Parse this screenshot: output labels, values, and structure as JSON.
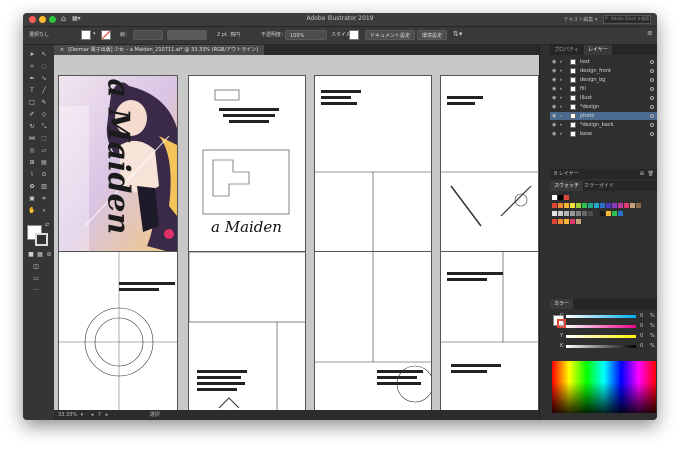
{
  "window": {
    "title": "Adobe Illustrator 2019",
    "workspace_label": "テキスト編集",
    "stock_search_placeholder": "Adobe Stock を検索"
  },
  "control_bar": {
    "selection_label": "選択なし",
    "stroke_label": "線：",
    "stroke_weight": "2 pt. 楕円",
    "opacity_label": "不透明度：",
    "opacity_value": "100%",
    "style_label": "スタイル：",
    "doc_settings_button": "ドキュメント設定",
    "preferences_button": "環境設定"
  },
  "document_tab": {
    "label": "[Dermar 電子出版] 少女 – a Maiden_210711.ai* @ 33.33% (RGB/アウトライン)",
    "close": "×"
  },
  "status": {
    "zoom": "33.33%",
    "page": "7",
    "tool": "選択"
  },
  "artwork": {
    "cover_title": "a Maiden",
    "spread_title": "a Maiden"
  },
  "panels": {
    "tab_properties": "プロパティ",
    "tab_layers": "レイヤー",
    "layers_footer": "8 レイヤー",
    "tab_swatches": "スウォッチ",
    "tab_color_guide": "カラーガイド",
    "tab_color": "カラー"
  },
  "layers": [
    {
      "name": "text",
      "selected": false
    },
    {
      "name": "design_front",
      "selected": false
    },
    {
      "name": "design_bg",
      "selected": false
    },
    {
      "name": "fill",
      "selected": false
    },
    {
      "name": "Illust",
      "selected": false
    },
    {
      "name": "*design",
      "selected": false
    },
    {
      "name": "photo",
      "selected": true
    },
    {
      "name": "*design_back",
      "selected": false
    },
    {
      "name": "base",
      "selected": false
    }
  ],
  "color": {
    "channels": [
      {
        "label": "C",
        "value": "0",
        "unit": "%"
      },
      {
        "label": "M",
        "value": "0",
        "unit": "%"
      },
      {
        "label": "Y",
        "value": "0",
        "unit": "%"
      },
      {
        "label": "K",
        "value": "0",
        "unit": "%"
      }
    ]
  },
  "colors": {
    "window_bg": "#323232",
    "canvas_bg": "#c8c8c8",
    "selected_layer": "#4a6b8f",
    "accent_red": "#e0453a",
    "accent_yellow": "#f4b73a",
    "accent_green": "#2cc14a"
  },
  "icons": [
    "home-icon",
    "layout-icon",
    "selection-tool-icon",
    "direct-selection-icon",
    "pen-icon",
    "type-icon",
    "line-icon",
    "rectangle-icon",
    "brush-icon",
    "pencil-icon",
    "eraser-icon",
    "rotate-icon",
    "scale-icon",
    "width-icon",
    "shape-builder-icon",
    "perspective-icon",
    "mesh-icon",
    "gradient-icon",
    "eyedropper-icon",
    "blend-icon",
    "symbol-icon",
    "graph-icon",
    "artboard-icon",
    "slice-icon",
    "hand-icon",
    "zoom-icon",
    "fill-swatch-icon",
    "stroke-swatch-icon",
    "eye-icon",
    "lock-icon"
  ]
}
